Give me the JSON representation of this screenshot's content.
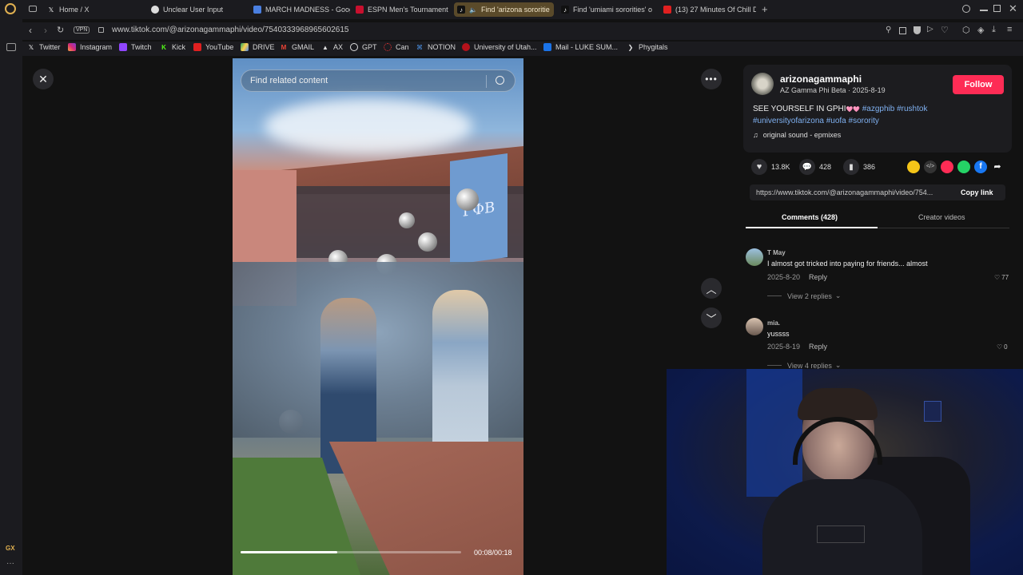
{
  "browser": {
    "tabs": [
      {
        "label": "Home / X",
        "icon": "x-icon"
      },
      {
        "label": "Unclear User Input",
        "icon": "gpt-icon"
      },
      {
        "label": "MARCH MADNESS - Goog",
        "icon": "docs-icon"
      },
      {
        "label": "ESPN Men's Tournament",
        "icon": "espn-icon"
      },
      {
        "label": "Find 'arizona sororitie",
        "icon": "tiktok-icon"
      },
      {
        "label": "Find 'umiami sororities' o",
        "icon": "tiktok-icon"
      },
      {
        "label": "(13) 27 Minutes Of Chill De",
        "icon": "youtube-icon"
      }
    ],
    "url": "www.tiktok.com/@arizonagammaphi/video/7540333968965602615",
    "vpn_label": "VPN",
    "bookmarks": [
      {
        "label": "Twitter",
        "icon": "x-icon"
      },
      {
        "label": "Instagram",
        "icon": "instagram-icon"
      },
      {
        "label": "Twitch",
        "icon": "twitch-icon"
      },
      {
        "label": "Kick",
        "icon": "kick-icon"
      },
      {
        "label": "YouTube",
        "icon": "youtube-icon"
      },
      {
        "label": "DRIVE",
        "icon": "drive-icon"
      },
      {
        "label": "GMAIL",
        "icon": "gmail-icon"
      },
      {
        "label": "AX",
        "icon": "ax-icon"
      },
      {
        "label": "GPT",
        "icon": "gpt-icon"
      },
      {
        "label": "Can",
        "icon": "can-icon"
      },
      {
        "label": "NOTION",
        "icon": "notion-icon"
      },
      {
        "label": "University of Utah...",
        "icon": "utah-icon"
      },
      {
        "label": "Mail - LUKE SUM...",
        "icon": "mail-icon"
      },
      {
        "label": "Phygitals",
        "icon": "phygitals-icon"
      }
    ],
    "left_rail_label": "GX"
  },
  "video": {
    "search_placeholder": "Find related content",
    "time": "00:08/00:18",
    "progress": 0.44,
    "banner_text": "ΓΦΒ"
  },
  "post": {
    "username": "arizonagammaphi",
    "display_name": "AZ Gamma Phi Beta",
    "date": "2025-8-19",
    "follow_label": "Follow",
    "caption_prefix": "SEE YOURSELF IN GPHI",
    "caption_glyphs": "🩷🩷",
    "hashtags_line1": "#azgphib #rushtok",
    "hashtags_line2": "#universityofarizona #uofa #sorority",
    "sound": "original sound - epmixes",
    "likes": "13.8K",
    "comments": "428",
    "saves": "386",
    "link": "https://www.tiktok.com/@arizonagammaphi/video/754...",
    "copy_link_label": "Copy link",
    "tab_comments": "Comments (428)",
    "tab_creator": "Creator videos"
  },
  "comments": [
    {
      "author": "T May",
      "text": "I almost got tricked into paying for friends... almost",
      "date": "2025-8-20",
      "reply": "Reply",
      "likes": "77",
      "view_replies": "View 2 replies"
    },
    {
      "author": "mia.",
      "text": "yussss",
      "date": "2025-8-19",
      "reply": "Reply",
      "likes": "0",
      "view_replies": "View 4 replies"
    }
  ],
  "colors": {
    "accent": "#fe2c55",
    "hashtag": "#7fb0f0",
    "active_tab": "#5a4a2a"
  }
}
